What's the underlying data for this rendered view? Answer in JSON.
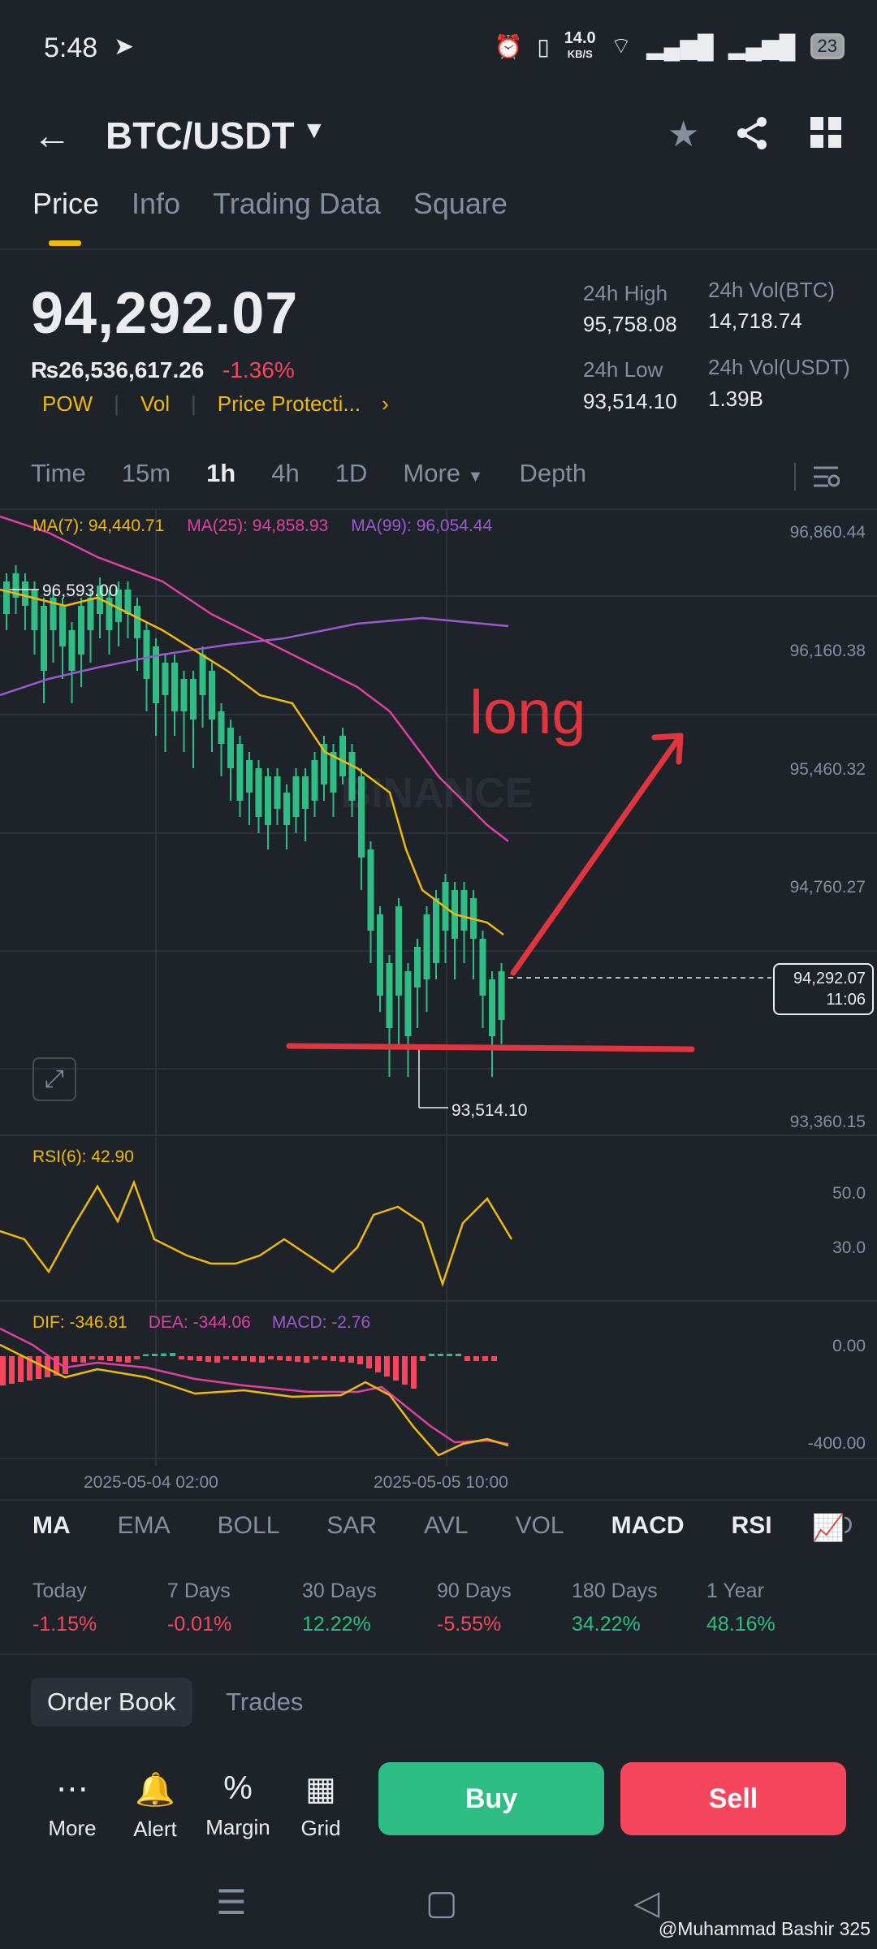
{
  "status": {
    "time": "5:48",
    "speed": "14.0",
    "speed_unit": "KB/S",
    "battery": "23"
  },
  "header": {
    "pair": "BTC/USDT"
  },
  "tabs": [
    "Price",
    "Info",
    "Trading Data",
    "Square"
  ],
  "ticker": {
    "price": "94,292.07",
    "fiat": "₨26,536,617.26",
    "change": "-1.36%",
    "tags": [
      "POW",
      "Vol",
      "Price Protecti..."
    ],
    "high_label": "24h High",
    "high": "95,758.08",
    "low_label": "24h Low",
    "low": "93,514.10",
    "vol_btc_label": "24h Vol(BTC)",
    "vol_btc": "14,718.74",
    "vol_usdt_label": "24h Vol(USDT)",
    "vol_usdt": "1.39B"
  },
  "intervals": [
    "Time",
    "15m",
    "1h",
    "4h",
    "1D",
    "More",
    "Depth"
  ],
  "chart": {
    "ma7": "MA(7): 94,440.71",
    "ma25": "MA(25): 94,858.93",
    "ma99": "MA(99): 96,054.44",
    "y_ticks": [
      "96,860.44",
      "96,160.38",
      "95,460.32",
      "94,760.27",
      "93,360.15"
    ],
    "high_marker": "96,593.00",
    "low_marker": "93,514.10",
    "last_price": "94,292.07",
    "countdown": "11:06",
    "watermark": "BINANCE",
    "annotation": "long",
    "rsi_label": "RSI(6): 42.90",
    "rsi_ticks": [
      "50.0",
      "30.0"
    ],
    "dif": "DIF: -346.81",
    "dea": "DEA: -344.06",
    "macd": "MACD: -2.76",
    "macd_ticks": [
      "0.00",
      "-400.00"
    ],
    "x_ticks": [
      "2025-05-04 02:00",
      "2025-05-05 10:00"
    ],
    "colors": {
      "up": "#2ebd85",
      "down": "#f6465d",
      "ma7": "#f0b90b",
      "ma25": "#e040a0",
      "ma99": "#9b59d0"
    }
  },
  "indicators": [
    "MA",
    "EMA",
    "BOLL",
    "SAR",
    "AVL",
    "VOL",
    "MACD",
    "RSI",
    "KD"
  ],
  "performance": [
    {
      "label": "Today",
      "value": "-1.15%"
    },
    {
      "label": "7 Days",
      "value": "-0.01%"
    },
    {
      "label": "30 Days",
      "value": "12.22%"
    },
    {
      "label": "90 Days",
      "value": "-5.55%"
    },
    {
      "label": "180 Days",
      "value": "34.22%"
    },
    {
      "label": "1 Year",
      "value": "48.16%"
    }
  ],
  "book_tabs": [
    "Order Book",
    "Trades"
  ],
  "actions": [
    "More",
    "Alert",
    "Margin",
    "Grid"
  ],
  "buy": "Buy",
  "sell": "Sell",
  "watermark_user": "@Muhammad Bashir 325"
}
